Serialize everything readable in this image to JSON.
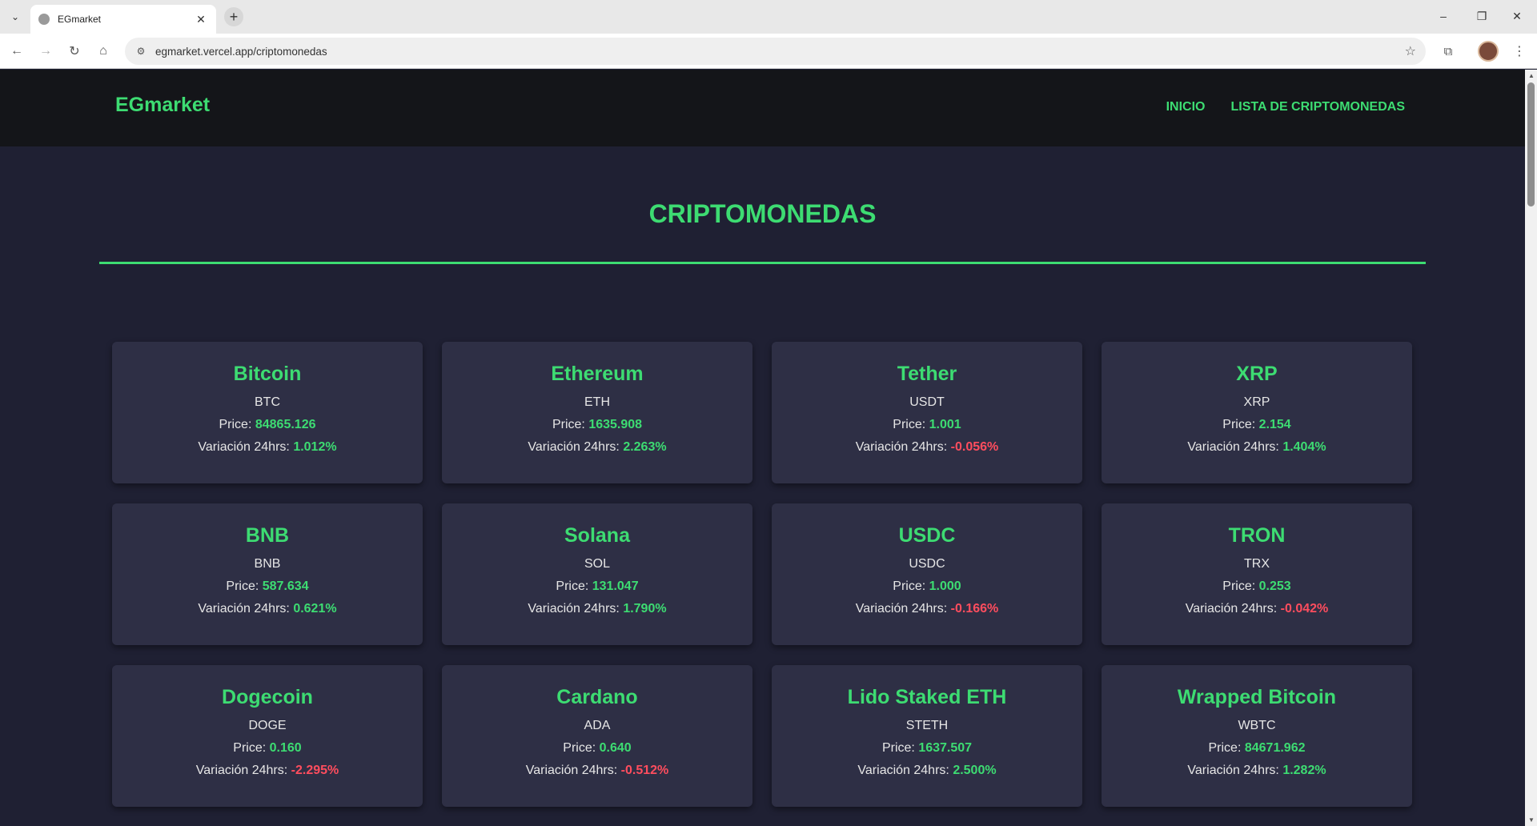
{
  "browser": {
    "tab_title": "EGmarket",
    "url": "egmarket.vercel.app/criptomonedas"
  },
  "header": {
    "brand": "EGmarket",
    "nav": [
      {
        "label": "INICIO"
      },
      {
        "label": "LISTA DE CRIPTOMONEDAS"
      }
    ]
  },
  "main": {
    "title": "CRIPTOMONEDAS",
    "price_label": "Price:",
    "change_label": "Variación 24hrs:",
    "coins": [
      {
        "name": "Bitcoin",
        "symbol": "BTC",
        "price": "84865.126",
        "change": "1.012%",
        "trend": "pos"
      },
      {
        "name": "Ethereum",
        "symbol": "ETH",
        "price": "1635.908",
        "change": "2.263%",
        "trend": "pos"
      },
      {
        "name": "Tether",
        "symbol": "USDT",
        "price": "1.001",
        "change": "-0.056%",
        "trend": "neg"
      },
      {
        "name": "XRP",
        "symbol": "XRP",
        "price": "2.154",
        "change": "1.404%",
        "trend": "pos"
      },
      {
        "name": "BNB",
        "symbol": "BNB",
        "price": "587.634",
        "change": "0.621%",
        "trend": "pos"
      },
      {
        "name": "Solana",
        "symbol": "SOL",
        "price": "131.047",
        "change": "1.790%",
        "trend": "pos"
      },
      {
        "name": "USDC",
        "symbol": "USDC",
        "price": "1.000",
        "change": "-0.166%",
        "trend": "neg"
      },
      {
        "name": "TRON",
        "symbol": "TRX",
        "price": "0.253",
        "change": "-0.042%",
        "trend": "neg"
      },
      {
        "name": "Dogecoin",
        "symbol": "DOGE",
        "price": "0.160",
        "change": "-2.295%",
        "trend": "neg"
      },
      {
        "name": "Cardano",
        "symbol": "ADA",
        "price": "0.640",
        "change": "-0.512%",
        "trend": "neg"
      },
      {
        "name": "Lido Staked ETH",
        "symbol": "STETH",
        "price": "1637.507",
        "change": "2.500%",
        "trend": "pos"
      },
      {
        "name": "Wrapped Bitcoin",
        "symbol": "WBTC",
        "price": "84671.962",
        "change": "1.282%",
        "trend": "pos"
      }
    ]
  },
  "colors": {
    "accent": "#3ddc72",
    "negative": "#ff4d5e",
    "background": "#1f2033",
    "card": "#2e2f45",
    "header": "#141519"
  }
}
